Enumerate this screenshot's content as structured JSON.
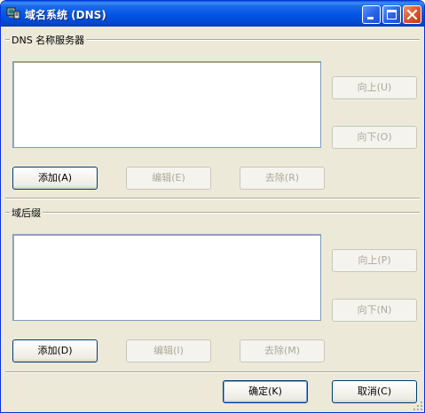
{
  "window": {
    "title": "域名系统 (DNS)"
  },
  "dns_servers": {
    "group_label": "DNS 名称服务器",
    "up_label": "向上(U)",
    "down_label": "向下(O)",
    "add_label": "添加(A)",
    "edit_label": "编辑(E)",
    "remove_label": "去除(R)"
  },
  "domain_suffix": {
    "group_label": "域后缀",
    "up_label": "向上(P)",
    "down_label": "向下(N)",
    "add_label": "添加(D)",
    "edit_label": "编辑(I)",
    "remove_label": "去除(M)"
  },
  "footer": {
    "ok_label": "确定(K)",
    "cancel_label": "取消(C)"
  },
  "colors": {
    "titlebar": "#0055e5",
    "dialog_bg": "#ece9d8",
    "disabled_text": "#aca899"
  },
  "icons": {
    "title": "network-computer-icon",
    "minimize": "minimize-icon",
    "maximize": "maximize-icon",
    "close": "close-icon"
  }
}
